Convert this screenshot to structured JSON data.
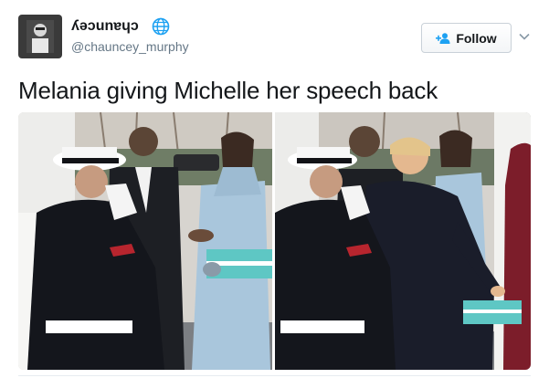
{
  "user": {
    "display_name": "ʎǝɔunɐɥɔ",
    "handle": "@chauncey_murphy",
    "avatar_icon": "avatar-photo",
    "badge_icon": "globe-icon"
  },
  "actions": {
    "follow_label": "Follow",
    "follow_icon": "add-person-icon",
    "menu_icon": "chevron-down-icon"
  },
  "tweet": {
    "text": "Melania giving Michelle her speech back"
  },
  "media": {
    "photos": [
      "photo-left",
      "photo-right"
    ]
  },
  "colors": {
    "follow_icon": "#1da1f2",
    "handle": "#657786",
    "coat_blue": "#a9c6dc",
    "gift_box": "#5ec7c4",
    "marine_uniform": "#14161c"
  }
}
